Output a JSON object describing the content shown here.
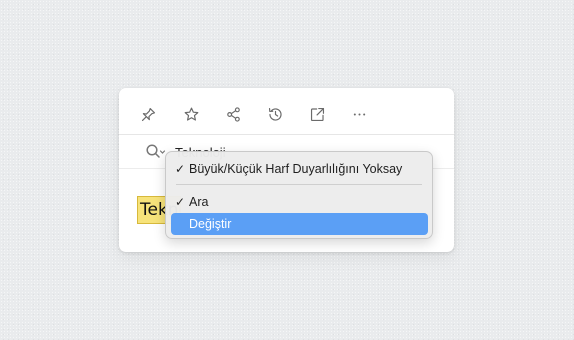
{
  "toolbar": {
    "icons": [
      "pin-icon",
      "star-icon",
      "share-icon",
      "history-icon",
      "open-external-icon",
      "more-icon"
    ]
  },
  "search": {
    "value": "Teknoloji"
  },
  "document": {
    "highlighted_text": "Teknoloji"
  },
  "menu": {
    "items": [
      {
        "label": "Büyük/Küçük Harf Duyarlılığını Yoksay",
        "checked": true,
        "check": "✓"
      },
      {
        "label": "Ara",
        "checked": true,
        "check": "✓"
      },
      {
        "label": "Değiştir",
        "checked": false,
        "selected": true
      }
    ]
  },
  "colors": {
    "highlight": "#f7e37a",
    "selection": "#5b9ff5"
  }
}
